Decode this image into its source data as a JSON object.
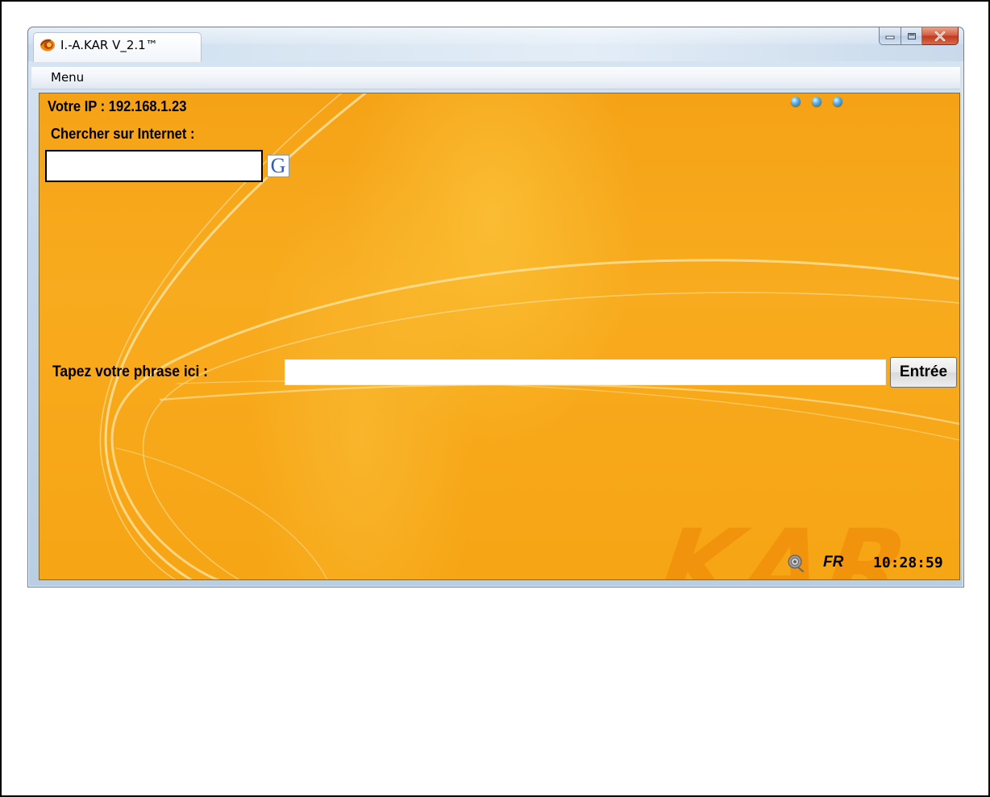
{
  "window": {
    "title": "I.-A.KAR V_2.1™",
    "app_icon": "swirl-app-icon",
    "controls": {
      "minimize_icon": "minimize-icon",
      "maximize_icon": "maximize-icon",
      "close_icon": "close-icon"
    }
  },
  "menubar": {
    "items": [
      {
        "label": "Menu"
      }
    ]
  },
  "main": {
    "ip_text": "Votre IP : 192.168.1.23",
    "search": {
      "label": "Chercher sur Internet :",
      "value": "",
      "placeholder": "",
      "button_glyph": "G"
    },
    "phrase": {
      "label": "Tapez votre phrase ici :",
      "value": "",
      "placeholder": "",
      "button_label": "Entrée"
    },
    "watermark": "KAR",
    "status": {
      "speaker_icon": "speaker-icon",
      "language": "FR",
      "time": "10:28:59"
    },
    "indicator_dots": 3
  },
  "colors": {
    "background_orange": "#f8ab1e",
    "watermark": "#f08f0a",
    "dot_blue": "#5bb4e6"
  }
}
